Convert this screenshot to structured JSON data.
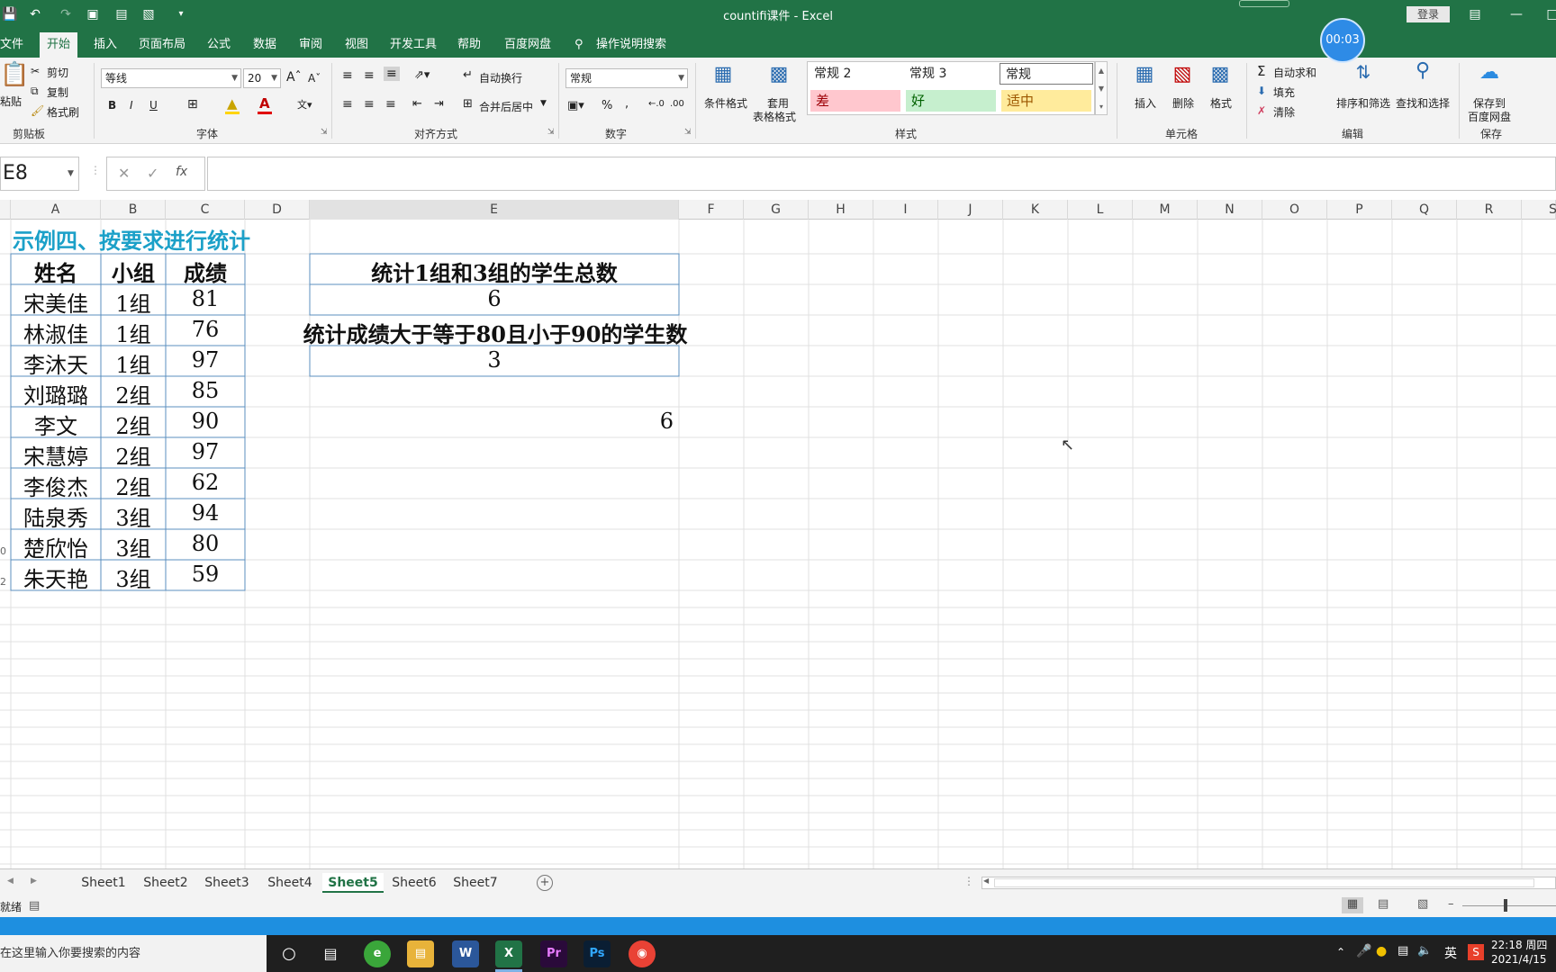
{
  "title_bar": {
    "title": "countifi课件  -  Excel",
    "login_label": "登录",
    "timer": "00:03"
  },
  "tabs": [
    "文件",
    "开始",
    "插入",
    "页面布局",
    "公式",
    "数据",
    "审阅",
    "视图",
    "开发工具",
    "帮助",
    "百度网盘",
    "操作说明搜索"
  ],
  "ribbon": {
    "clipboard": {
      "paste": "粘贴",
      "cut": "剪切",
      "copy": "复制",
      "format_painter": "格式刷",
      "label": "剪贴板"
    },
    "font": {
      "font_name": "等线",
      "font_size": "20",
      "label": "字体"
    },
    "alignment": {
      "wrap": "自动换行",
      "merge": "合并后居中",
      "label": "对齐方式"
    },
    "number": {
      "format": "常规",
      "label": "数字"
    },
    "styles": {
      "conditional": "条件格式",
      "table_format_1": "套用",
      "table_format_2": "表格格式",
      "normal2": "常规 2",
      "normal3": "常规 3",
      "normal": "常规",
      "bad": "差",
      "good": "好",
      "neutral": "适中",
      "label": "样式"
    },
    "cells": {
      "insert": "插入",
      "delete": "删除",
      "format": "格式",
      "label": "单元格"
    },
    "editing": {
      "autosum": "自动求和",
      "fill": "填充",
      "clear": "清除",
      "sort_filter": "排序和筛选",
      "find_select": "查找和选择",
      "label": "编辑"
    },
    "save": {
      "line1": "保存到",
      "line2": "百度网盘",
      "label": "保存"
    }
  },
  "formula_bar": {
    "name_box": "E8",
    "formula": ""
  },
  "columns": [
    "A",
    "B",
    "C",
    "D",
    "E",
    "F",
    "G",
    "H",
    "I",
    "J",
    "K",
    "L",
    "M",
    "N",
    "O",
    "P",
    "Q",
    "R",
    "S"
  ],
  "sheet": {
    "title": "示例四、按要求进行统计",
    "headers": [
      "姓名",
      "小组",
      "成绩"
    ],
    "rows": [
      [
        "宋美佳",
        "1组",
        "81"
      ],
      [
        "林淑佳",
        "1组",
        "76"
      ],
      [
        "李沐天",
        "1组",
        "97"
      ],
      [
        "刘璐璐",
        "2组",
        "85"
      ],
      [
        "李文",
        "2组",
        "90"
      ],
      [
        "宋慧婷",
        "2组",
        "97"
      ],
      [
        "李俊杰",
        "2组",
        "62"
      ],
      [
        "陆泉秀",
        "3组",
        "94"
      ],
      [
        "楚欣怡",
        "3组",
        "80"
      ],
      [
        "朱天艳",
        "3组",
        "59"
      ]
    ],
    "q1_label": "统计1组和3组的学生总数",
    "q1_value": "6",
    "q2_label": "统计成绩大于等于80且小于90的学生数",
    "q2_value": "3",
    "e7_value": "6"
  },
  "sheet_tabs": [
    "Sheet1",
    "Sheet2",
    "Sheet3",
    "Sheet4",
    "Sheet5",
    "Sheet6",
    "Sheet7"
  ],
  "active_sheet": "Sheet5",
  "status": {
    "ready": "就绪"
  },
  "taskbar": {
    "search_placeholder": "在这里输入你要搜索的内容",
    "ime": "英",
    "time": "22:18 周四",
    "date": "2021/4/15"
  },
  "colors": {
    "excel_green": "#217346",
    "title_cyan": "#1ba0c8",
    "border_blue": "#4a86b4"
  }
}
